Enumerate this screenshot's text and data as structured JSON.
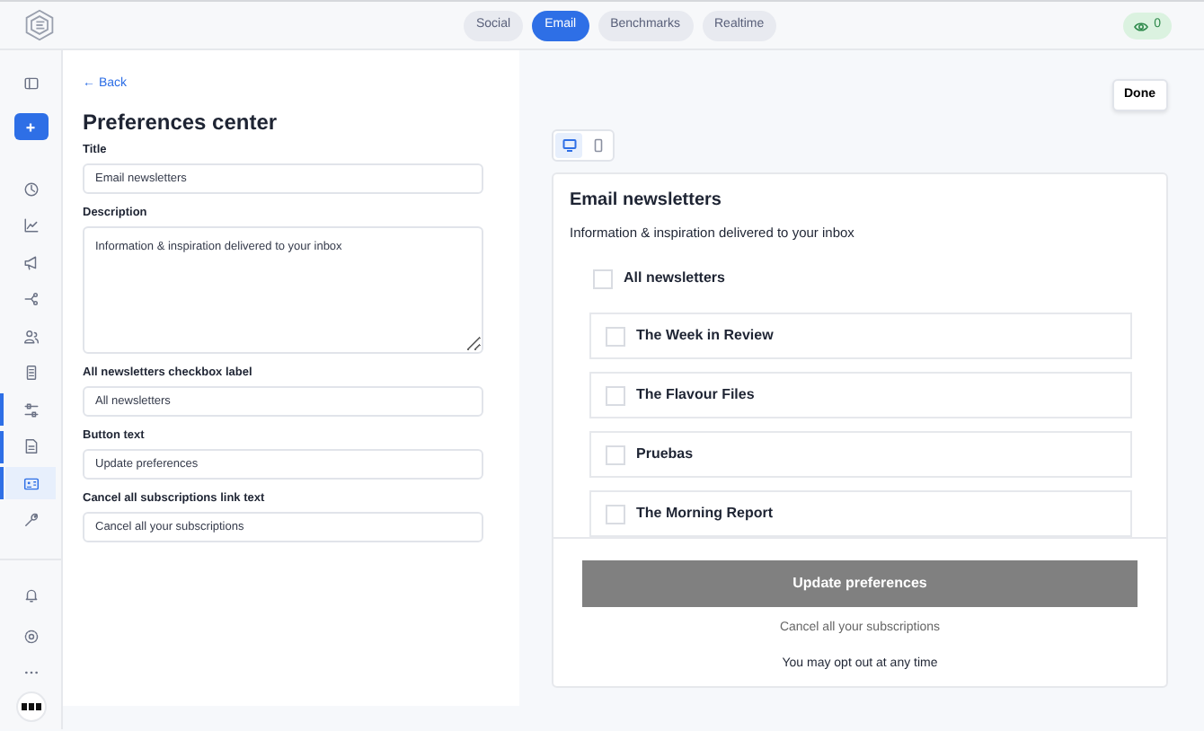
{
  "header": {
    "tabs": [
      {
        "label": "Social",
        "selected": false
      },
      {
        "label": "Email",
        "selected": true
      },
      {
        "label": "Benchmarks",
        "selected": false
      },
      {
        "label": "Realtime",
        "selected": false
      }
    ],
    "viewers_badge": "0"
  },
  "sidebar": {
    "items": [
      {
        "selected": false,
        "in_section": false
      },
      {
        "selected": false,
        "in_section": false
      },
      {
        "selected": false,
        "in_section": false
      },
      {
        "selected": false,
        "in_section": false
      },
      {
        "selected": false,
        "in_section": false
      },
      {
        "selected": false,
        "in_section": false
      },
      {
        "selected": false,
        "in_section": false
      },
      {
        "selected": false,
        "in_section": false
      },
      {
        "selected": false,
        "in_section": true
      },
      {
        "selected": false,
        "in_section": true
      },
      {
        "selected": true,
        "in_section": true
      },
      {
        "selected": false,
        "in_section": false
      }
    ]
  },
  "editor": {
    "back_link": "← Back",
    "heading": "Preferences center",
    "fields": [
      {
        "label": "Title",
        "value": "Email newsletters",
        "kind": "input"
      },
      {
        "label": "Description",
        "value": "Information & inspiration delivered to your inbox",
        "kind": "textarea"
      },
      {
        "label": "All newsletters checkbox label",
        "value": "All newsletters",
        "kind": "input"
      },
      {
        "label": "Button text",
        "value": "Update preferences",
        "kind": "input"
      },
      {
        "label": "Cancel all subscriptions link text",
        "value": "Cancel all your subscriptions",
        "kind": "input"
      }
    ]
  },
  "preview": {
    "done_button": "Done",
    "devices": [
      {
        "kind": "desktop",
        "selected": true
      },
      {
        "kind": "mobile",
        "selected": false
      }
    ],
    "title": "Email newsletters",
    "description": "Information & inspiration delivered to your inbox",
    "all_checkbox": {
      "label": "All newsletters",
      "checked": false
    },
    "newsletters": [
      {
        "name": "The Week in Review",
        "checked": false
      },
      {
        "name": "The Flavour Files",
        "checked": false
      },
      {
        "name": "Pruebas",
        "checked": false
      },
      {
        "name": "The Morning Report",
        "checked": false
      }
    ],
    "submit_button": "Update preferences",
    "cancel_link": "Cancel all your subscriptions",
    "note": "You may opt out at any time"
  }
}
